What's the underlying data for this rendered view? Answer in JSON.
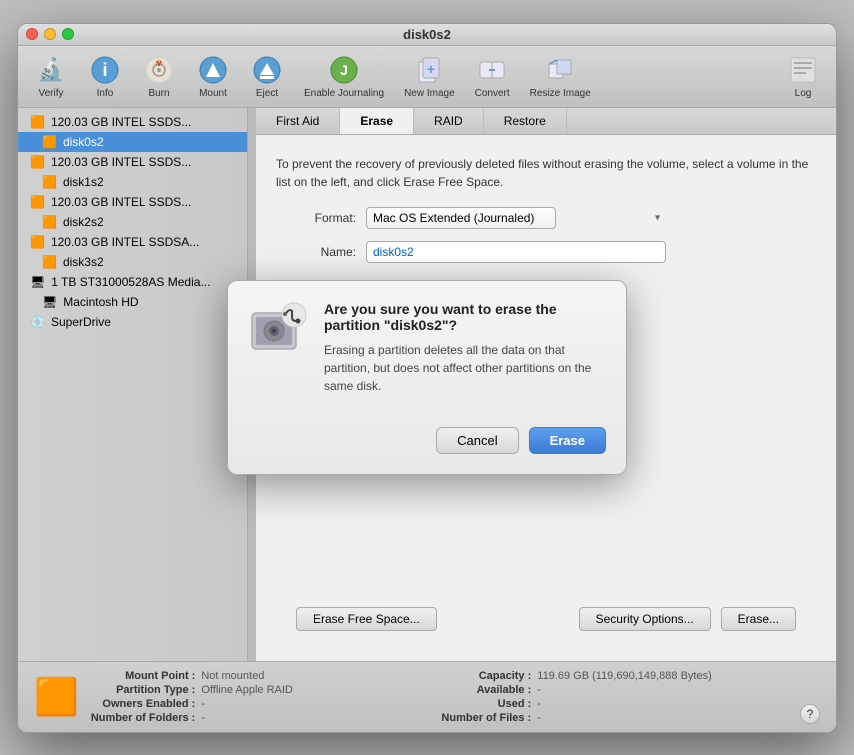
{
  "window": {
    "title": "disk0s2"
  },
  "toolbar": {
    "buttons": [
      {
        "id": "verify",
        "label": "Verify",
        "icon": "🔬"
      },
      {
        "id": "info",
        "label": "Info",
        "icon": "ℹ️"
      },
      {
        "id": "burn",
        "label": "Burn",
        "icon": "💿"
      },
      {
        "id": "mount",
        "label": "Mount",
        "icon": "⏏"
      },
      {
        "id": "eject",
        "label": "Eject",
        "icon": "⏏"
      },
      {
        "id": "enable-journaling",
        "label": "Enable Journaling",
        "icon": "📋"
      },
      {
        "id": "new-image",
        "label": "New Image",
        "icon": "🖼"
      },
      {
        "id": "convert",
        "label": "Convert",
        "icon": "🔄"
      },
      {
        "id": "resize-image",
        "label": "Resize Image",
        "icon": "📐"
      }
    ],
    "log_label": "Log"
  },
  "sidebar": {
    "items": [
      {
        "id": "disk0-1",
        "label": "120.03 GB INTEL SSDS...",
        "type": "disk",
        "level": 0
      },
      {
        "id": "disk0s2",
        "label": "disk0s2",
        "type": "partition",
        "level": 1,
        "selected": true
      },
      {
        "id": "disk1",
        "label": "120.03 GB INTEL SSDS...",
        "type": "disk",
        "level": 0
      },
      {
        "id": "disk1s2",
        "label": "disk1s2",
        "type": "partition",
        "level": 1,
        "selected": false
      },
      {
        "id": "disk2",
        "label": "120.03 GB INTEL SSDS...",
        "type": "disk",
        "level": 0
      },
      {
        "id": "disk2s2",
        "label": "disk2s2",
        "type": "partition",
        "level": 1,
        "selected": false
      },
      {
        "id": "disk3",
        "label": "120.03 GB INTEL SSDSA...",
        "type": "disk",
        "level": 0
      },
      {
        "id": "disk3s2",
        "label": "disk3s2",
        "type": "partition",
        "level": 1,
        "selected": false
      },
      {
        "id": "disk4",
        "label": "1 TB ST31000528AS Media...",
        "type": "disk",
        "level": 0
      },
      {
        "id": "macintosh-hd",
        "label": "Macintosh HD",
        "type": "volume",
        "level": 1,
        "selected": false
      },
      {
        "id": "superdrive",
        "label": "SuperDrive",
        "type": "optical",
        "level": 0
      }
    ]
  },
  "tabs": [
    {
      "id": "first-aid",
      "label": "First Aid"
    },
    {
      "id": "erase",
      "label": "Erase",
      "active": true
    },
    {
      "id": "raid",
      "label": "RAID"
    },
    {
      "id": "restore",
      "label": "Restore"
    }
  ],
  "erase_panel": {
    "description_security": "To prevent the recovery of previously deleted files without erasing the volume, select a volume in the list on the left, and click Erase Free Space.",
    "format_label": "Format:",
    "format_value": "Mac OS Extended (Journaled)",
    "name_label": "Name:",
    "name_value": "disk0s2",
    "btn_erase_free_space": "Erase Free Space...",
    "btn_security_options": "Security Options...",
    "btn_erase": "Erase..."
  },
  "dialog": {
    "title": "Are you sure you want to erase the partition \"disk0s2\"?",
    "message": "Erasing a partition deletes all the data on that partition, but does not affect other partitions on the same disk.",
    "btn_cancel": "Cancel",
    "btn_erase": "Erase"
  },
  "status_bar": {
    "mount_point_label": "Mount Point :",
    "mount_point_value": "Not mounted",
    "partition_type_label": "Partition Type :",
    "partition_type_value": "Offline Apple RAID",
    "owners_enabled_label": "Owners Enabled :",
    "owners_enabled_value": "-",
    "number_of_folders_label": "Number of Folders :",
    "number_of_folders_value": "-",
    "capacity_label": "Capacity :",
    "capacity_value": "119.69 GB (119,690,149,888 Bytes)",
    "available_label": "Available :",
    "available_value": "-",
    "used_label": "Used :",
    "used_value": "-",
    "number_of_files_label": "Number of Files :",
    "number_of_files_value": "-"
  }
}
